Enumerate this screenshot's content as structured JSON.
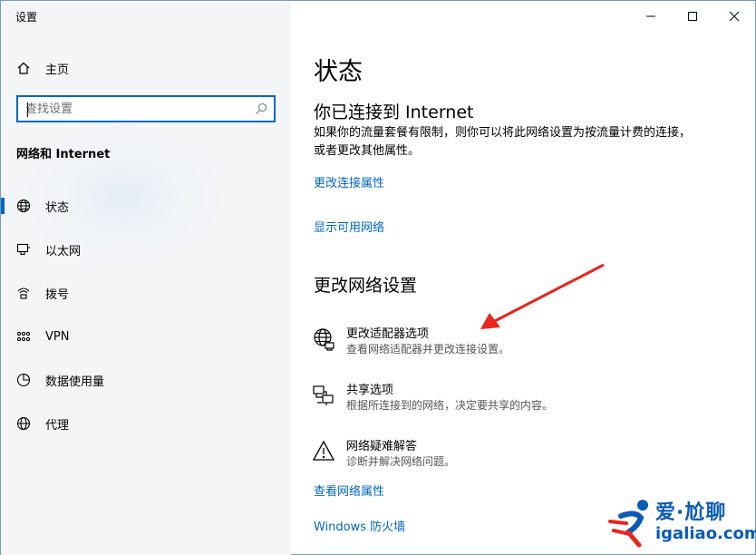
{
  "window": {
    "title": "设置"
  },
  "titlebar": {
    "minimize_icon": "minimize-icon",
    "maximize_icon": "maximize-icon",
    "close_icon": "close-icon"
  },
  "sidebar": {
    "home": {
      "label": "主页",
      "icon": "home-icon"
    },
    "search": {
      "placeholder": "查找设置",
      "icon": "search-icon"
    },
    "section_title": "网络和 Internet",
    "items": [
      {
        "label": "状态",
        "icon": "globe-icon",
        "selected": true
      },
      {
        "label": "以太网",
        "icon": "ethernet-icon"
      },
      {
        "label": "拨号",
        "icon": "dialup-icon"
      },
      {
        "label": "VPN",
        "icon": "vpn-icon"
      },
      {
        "label": "数据使用量",
        "icon": "data-usage-icon"
      },
      {
        "label": "代理",
        "icon": "proxy-globe-icon"
      }
    ]
  },
  "main": {
    "title": "状态",
    "connected_heading": "你已连接到 Internet",
    "connected_text": "如果你的流量套餐有限制，则你可以将此网络设置为按流量计费的连接，或者更改其他属性。",
    "link_change_props": "更改连接属性",
    "link_show_networks": "显示可用网络",
    "change_heading": "更改网络设置",
    "options": [
      {
        "title": "更改适配器选项",
        "desc": "查看网络适配器并更改连接设置。",
        "icon": "adapter-globe-icon"
      },
      {
        "title": "共享选项",
        "desc": "根据所连接到的网络，决定要共享的内容。",
        "icon": "sharing-icon"
      },
      {
        "title": "网络疑难解答",
        "desc": "诊断并解决网络问题。",
        "icon": "warning-icon"
      }
    ],
    "link_view_props": "查看网络属性",
    "link_firewall": "Windows 防火墙"
  },
  "watermark": {
    "line1": "爱·尬聊",
    "line2": "igaliao.com"
  },
  "colors": {
    "accent": "#0067c0",
    "arrow": "#e8261c",
    "watermark": "#0a5bb5"
  }
}
